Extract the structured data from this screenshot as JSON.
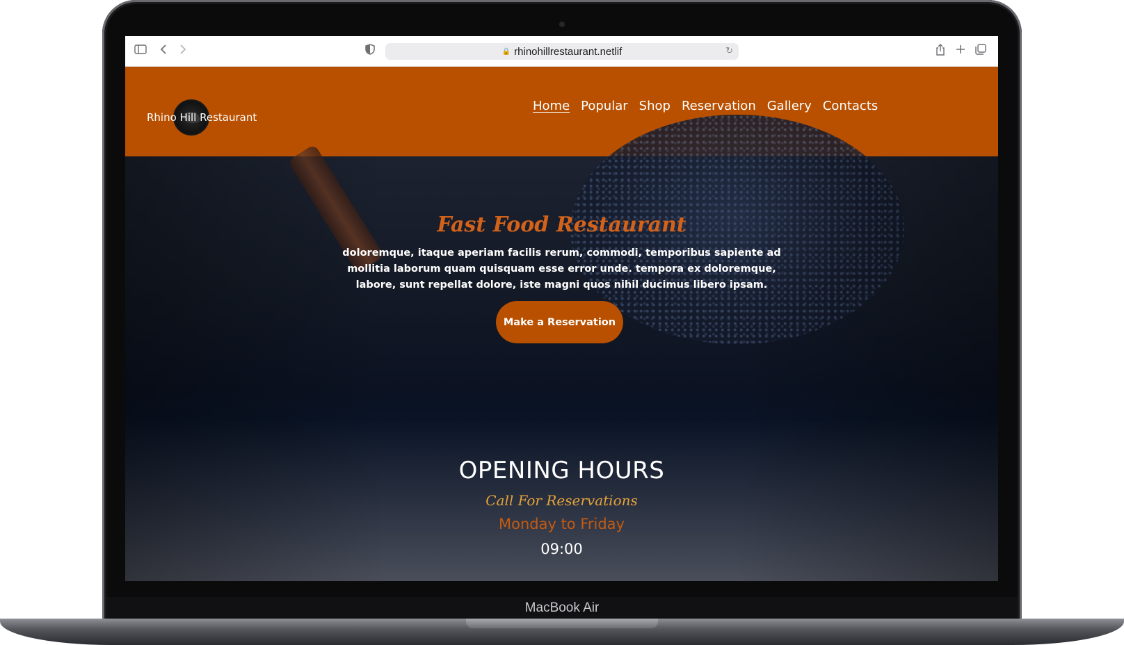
{
  "device": {
    "label": "MacBook Air"
  },
  "browser": {
    "url": "rhinohillrestaurant.netlif",
    "icons": [
      "sidebar-icon",
      "back-icon",
      "forward-icon",
      "shield-icon",
      "lock-icon",
      "reload-icon",
      "share-icon",
      "new-tab-icon",
      "tabs-icon"
    ]
  },
  "header": {
    "logo_text": "Rhino Hill Restaurant",
    "nav": [
      {
        "label": "Home",
        "active": true
      },
      {
        "label": "Popular"
      },
      {
        "label": "Shop"
      },
      {
        "label": "Reservation"
      },
      {
        "label": "Gallery"
      },
      {
        "label": "Contacts"
      }
    ],
    "colors": {
      "header_bg": "#b95000"
    }
  },
  "hero": {
    "title": "Fast Food Restaurant",
    "text": "doloremque, itaque aperiam facilis rerum, commodi, temporibus sapiente ad mollitia laborum quam quisquam esse error unde. tempora ex doloremque, labore, sunt repellat dolore, iste magni quos nihil ducimus libero ipsam.",
    "cta_label": "Make a Reservation"
  },
  "hours": {
    "title": "OPENING HOURS",
    "subtitle": "Call For Reservations",
    "days": "Monday to Friday",
    "time": "09:00"
  }
}
